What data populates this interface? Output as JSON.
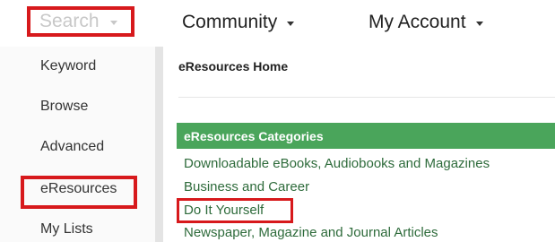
{
  "topnav": {
    "search_label": "Search",
    "community_label": "Community",
    "account_label": "My Account"
  },
  "sidebar": {
    "items": [
      {
        "label": "Keyword"
      },
      {
        "label": "Browse"
      },
      {
        "label": "Advanced"
      },
      {
        "label": "eResources",
        "highlighted": true
      },
      {
        "label": "My Lists"
      }
    ]
  },
  "main": {
    "breadcrumb": "eResources Home",
    "categories_header": "eResources Categories",
    "categories": [
      {
        "label": "Downloadable eBooks, Audiobooks and Magazines"
      },
      {
        "label": "Business and Career"
      },
      {
        "label": "Do It Yourself",
        "highlighted": true
      },
      {
        "label": "Newspaper, Magazine and Journal Articles"
      }
    ]
  },
  "colors": {
    "highlight_border": "#d7191c",
    "category_header_bg": "#4aa55b",
    "category_link": "#2e6b3b",
    "search_text": "#c8c8c8"
  },
  "icons": {
    "dropdown": "caret-down-icon"
  }
}
